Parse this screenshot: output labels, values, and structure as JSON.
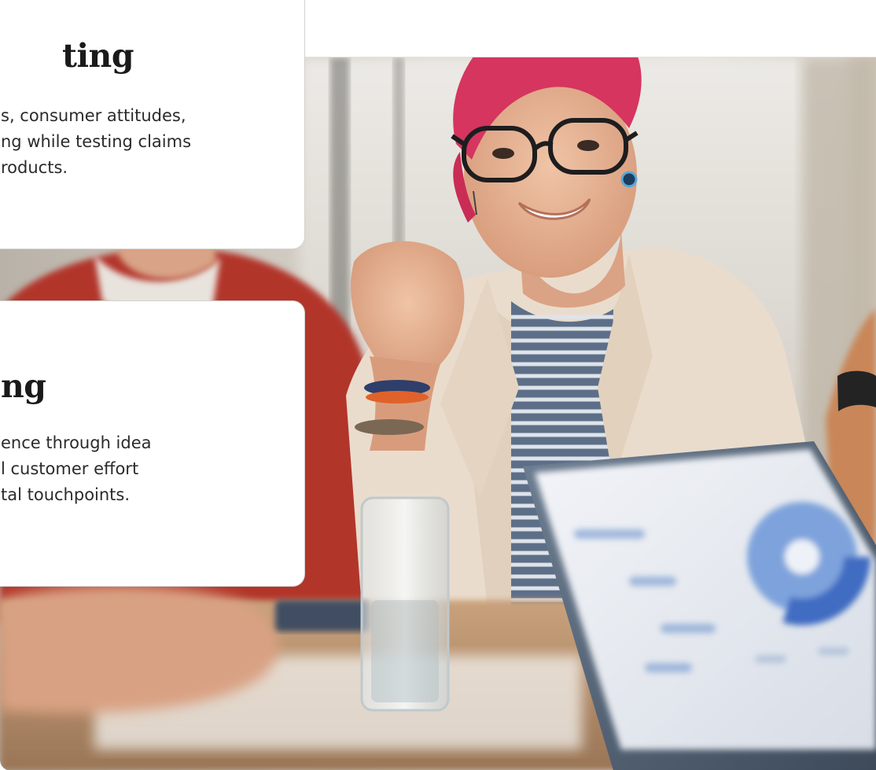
{
  "cards": [
    {
      "title": "ting",
      "lines": [
        "s, consumer attitudes,",
        "ng while testing claims",
        "roducts."
      ]
    },
    {
      "title": "ng",
      "lines": [
        "ence through idea",
        "l customer effort",
        "tal touchpoints."
      ]
    }
  ],
  "colors": {
    "card_border": "#d3d1cc",
    "heading_text": "#1a1a1a",
    "body_text": "#2b2b2b",
    "hair": "#d5355f",
    "blazer": "#eadccc",
    "red_jacket": "#b2352b"
  },
  "photo": {
    "subject": "meeting-photo"
  }
}
